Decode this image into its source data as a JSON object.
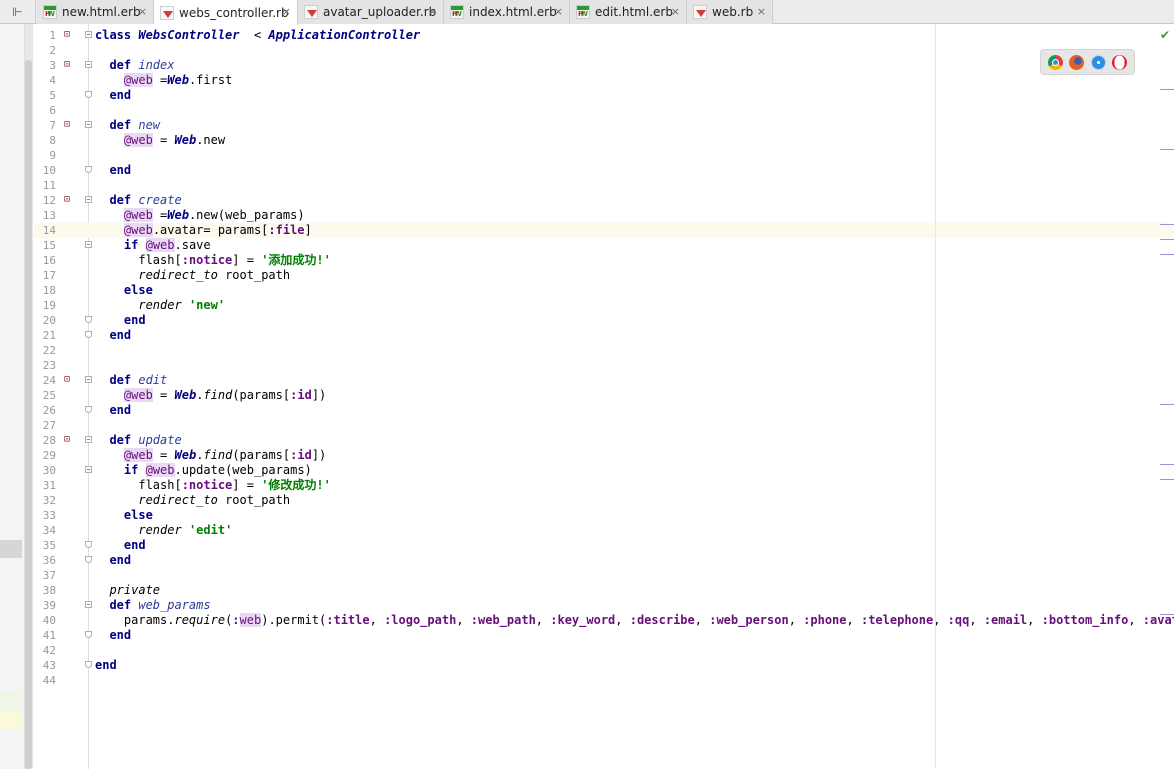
{
  "tabs": [
    {
      "label": "new.html.erb",
      "icon": "erb-file-icon",
      "active": false
    },
    {
      "label": "webs_controller.rb",
      "icon": "ruby-file-icon",
      "active": true
    },
    {
      "label": "avatar_uploader.rb",
      "icon": "ruby-file-icon",
      "active": false
    },
    {
      "label": "index.html.erb",
      "icon": "erb-file-icon",
      "active": false
    },
    {
      "label": "edit.html.erb",
      "icon": "erb-file-icon",
      "active": false
    },
    {
      "label": "web.rb",
      "icon": "ruby-file-icon",
      "active": false
    }
  ],
  "tab_close_glyph": "×",
  "sidebar_toggle_glyph": "⊩",
  "status_ok_glyph": "✔",
  "current_line": 14,
  "browser_icons": [
    "chrome-icon",
    "firefox-icon",
    "safari-icon",
    "opera-icon"
  ],
  "colors": {
    "keyword": "#000080",
    "instance_variable": "#660e7a",
    "string": "#008000",
    "current_line_bg": "#fcfaed"
  },
  "lines": [
    {
      "n": "1",
      "t": [
        [
          "kw",
          "class "
        ],
        [
          "cls",
          "WebsController"
        ],
        [
          "",
          "  < "
        ],
        [
          "cls",
          "ApplicationController"
        ]
      ]
    },
    {
      "n": "2",
      "t": []
    },
    {
      "n": "3",
      "t": [
        [
          "",
          "  "
        ],
        [
          "kw",
          "def "
        ],
        [
          "meth",
          "index"
        ]
      ]
    },
    {
      "n": "4",
      "t": [
        [
          "",
          "    "
        ],
        [
          "ivar",
          "@web"
        ],
        [
          "",
          " ="
        ],
        [
          "cls",
          "Web"
        ],
        [
          "",
          ".first"
        ]
      ]
    },
    {
      "n": "5",
      "t": [
        [
          "",
          "  "
        ],
        [
          "kw",
          "end"
        ]
      ]
    },
    {
      "n": "6",
      "t": []
    },
    {
      "n": "7",
      "t": [
        [
          "",
          "  "
        ],
        [
          "kw",
          "def "
        ],
        [
          "meth",
          "new"
        ]
      ]
    },
    {
      "n": "8",
      "t": [
        [
          "",
          "    "
        ],
        [
          "ivar",
          "@web"
        ],
        [
          "",
          " = "
        ],
        [
          "cls",
          "Web"
        ],
        [
          "",
          ".new"
        ]
      ]
    },
    {
      "n": "9",
      "t": []
    },
    {
      "n": "10",
      "t": [
        [
          "",
          "  "
        ],
        [
          "kw",
          "end"
        ]
      ]
    },
    {
      "n": "11",
      "t": []
    },
    {
      "n": "12",
      "t": [
        [
          "",
          "  "
        ],
        [
          "kw",
          "def "
        ],
        [
          "meth",
          "create"
        ]
      ]
    },
    {
      "n": "13",
      "t": [
        [
          "",
          "    "
        ],
        [
          "ivar",
          "@web"
        ],
        [
          "",
          " ="
        ],
        [
          "cls",
          "Web"
        ],
        [
          "",
          ".new(web_params)"
        ]
      ]
    },
    {
      "n": "14",
      "t": [
        [
          "",
          "    "
        ],
        [
          "ivar",
          "@web"
        ],
        [
          "",
          ".avatar= params["
        ],
        [
          "sym",
          ":file"
        ],
        [
          "",
          "]"
        ]
      ]
    },
    {
      "n": "15",
      "t": [
        [
          "",
          "    "
        ],
        [
          "kw",
          "if "
        ],
        [
          "ivar",
          "@web"
        ],
        [
          "",
          ".save"
        ]
      ]
    },
    {
      "n": "16",
      "t": [
        [
          "",
          "      flash["
        ],
        [
          "sym",
          ":notice"
        ],
        [
          "",
          "] = "
        ],
        [
          "str",
          "'添加成功!'"
        ]
      ]
    },
    {
      "n": "17",
      "t": [
        [
          "",
          "      "
        ],
        [
          "itl",
          "redirect_to"
        ],
        [
          "",
          " root_path"
        ]
      ]
    },
    {
      "n": "18",
      "t": [
        [
          "",
          "    "
        ],
        [
          "kw",
          "else"
        ]
      ]
    },
    {
      "n": "19",
      "t": [
        [
          "",
          "      "
        ],
        [
          "itl",
          "render"
        ],
        [
          "",
          " "
        ],
        [
          "str",
          "'new'"
        ]
      ]
    },
    {
      "n": "20",
      "t": [
        [
          "",
          "    "
        ],
        [
          "kw",
          "end"
        ]
      ]
    },
    {
      "n": "21",
      "t": [
        [
          "",
          "  "
        ],
        [
          "kw",
          "end"
        ]
      ]
    },
    {
      "n": "22",
      "t": []
    },
    {
      "n": "23",
      "t": []
    },
    {
      "n": "24",
      "t": [
        [
          "",
          "  "
        ],
        [
          "kw",
          "def "
        ],
        [
          "meth",
          "edit"
        ]
      ]
    },
    {
      "n": "25",
      "t": [
        [
          "",
          "    "
        ],
        [
          "ivar",
          "@web"
        ],
        [
          "",
          " = "
        ],
        [
          "cls",
          "Web"
        ],
        [
          "",
          "."
        ],
        [
          "itl",
          "find"
        ],
        [
          "",
          "(params["
        ],
        [
          "sym",
          ":id"
        ],
        [
          "",
          "])"
        ]
      ]
    },
    {
      "n": "26",
      "t": [
        [
          "",
          "  "
        ],
        [
          "kw",
          "end"
        ]
      ]
    },
    {
      "n": "27",
      "t": []
    },
    {
      "n": "28",
      "t": [
        [
          "",
          "  "
        ],
        [
          "kw",
          "def "
        ],
        [
          "meth",
          "update"
        ]
      ]
    },
    {
      "n": "29",
      "t": [
        [
          "",
          "    "
        ],
        [
          "ivar",
          "@web"
        ],
        [
          "",
          " = "
        ],
        [
          "cls",
          "Web"
        ],
        [
          "",
          "."
        ],
        [
          "itl",
          "find"
        ],
        [
          "",
          "(params["
        ],
        [
          "sym",
          ":id"
        ],
        [
          "",
          "])"
        ]
      ]
    },
    {
      "n": "30",
      "t": [
        [
          "",
          "    "
        ],
        [
          "kw",
          "if "
        ],
        [
          "ivar",
          "@web"
        ],
        [
          "",
          ".update(web_params)"
        ]
      ]
    },
    {
      "n": "31",
      "t": [
        [
          "",
          "      flash["
        ],
        [
          "sym",
          ":notice"
        ],
        [
          "",
          "] = "
        ],
        [
          "str",
          "'修改成功!'"
        ]
      ]
    },
    {
      "n": "32",
      "t": [
        [
          "",
          "      "
        ],
        [
          "itl",
          "redirect_to"
        ],
        [
          "",
          " root_path"
        ]
      ]
    },
    {
      "n": "33",
      "t": [
        [
          "",
          "    "
        ],
        [
          "kw",
          "else"
        ]
      ]
    },
    {
      "n": "34",
      "t": [
        [
          "",
          "      "
        ],
        [
          "itl",
          "render"
        ],
        [
          "",
          " "
        ],
        [
          "str",
          "'edit'"
        ]
      ]
    },
    {
      "n": "35",
      "t": [
        [
          "",
          "    "
        ],
        [
          "kw",
          "end"
        ]
      ]
    },
    {
      "n": "36",
      "t": [
        [
          "",
          "  "
        ],
        [
          "kw",
          "end"
        ]
      ]
    },
    {
      "n": "37",
      "t": []
    },
    {
      "n": "38",
      "t": [
        [
          "",
          "  "
        ],
        [
          "itl",
          "private"
        ]
      ]
    },
    {
      "n": "39",
      "t": [
        [
          "",
          "  "
        ],
        [
          "kw",
          "def "
        ],
        [
          "meth",
          "web_params"
        ]
      ]
    },
    {
      "n": "40",
      "t": [
        [
          "",
          "    params."
        ],
        [
          "itl",
          "require"
        ],
        [
          "",
          "("
        ],
        [
          "sym",
          ":"
        ],
        [
          "ivar",
          "web"
        ],
        [
          "",
          ").permit("
        ],
        [
          "sym",
          ":title"
        ],
        [
          "",
          ", "
        ],
        [
          "sym",
          ":logo_path"
        ],
        [
          "",
          ", "
        ],
        [
          "sym",
          ":web_path"
        ],
        [
          "",
          ", "
        ],
        [
          "sym",
          ":key_word"
        ],
        [
          "",
          ", "
        ],
        [
          "sym",
          ":describe"
        ],
        [
          "",
          ", "
        ],
        [
          "sym",
          ":web_person"
        ],
        [
          "",
          ", "
        ],
        [
          "sym",
          ":phone"
        ],
        [
          "",
          ", "
        ],
        [
          "sym",
          ":telephone"
        ],
        [
          "",
          ", "
        ],
        [
          "sym",
          ":qq"
        ],
        [
          "",
          ", "
        ],
        [
          "sym",
          ":email"
        ],
        [
          "",
          ", "
        ],
        [
          "sym",
          ":bottom_info"
        ],
        [
          "",
          ", "
        ],
        [
          "sym",
          ":avatar"
        ],
        [
          "",
          ")"
        ]
      ]
    },
    {
      "n": "41",
      "t": [
        [
          "",
          "  "
        ],
        [
          "kw",
          "end"
        ]
      ]
    },
    {
      "n": "42",
      "t": []
    },
    {
      "n": "43",
      "t": [
        [
          "kw",
          "end"
        ]
      ]
    },
    {
      "n": "44",
      "t": []
    }
  ]
}
